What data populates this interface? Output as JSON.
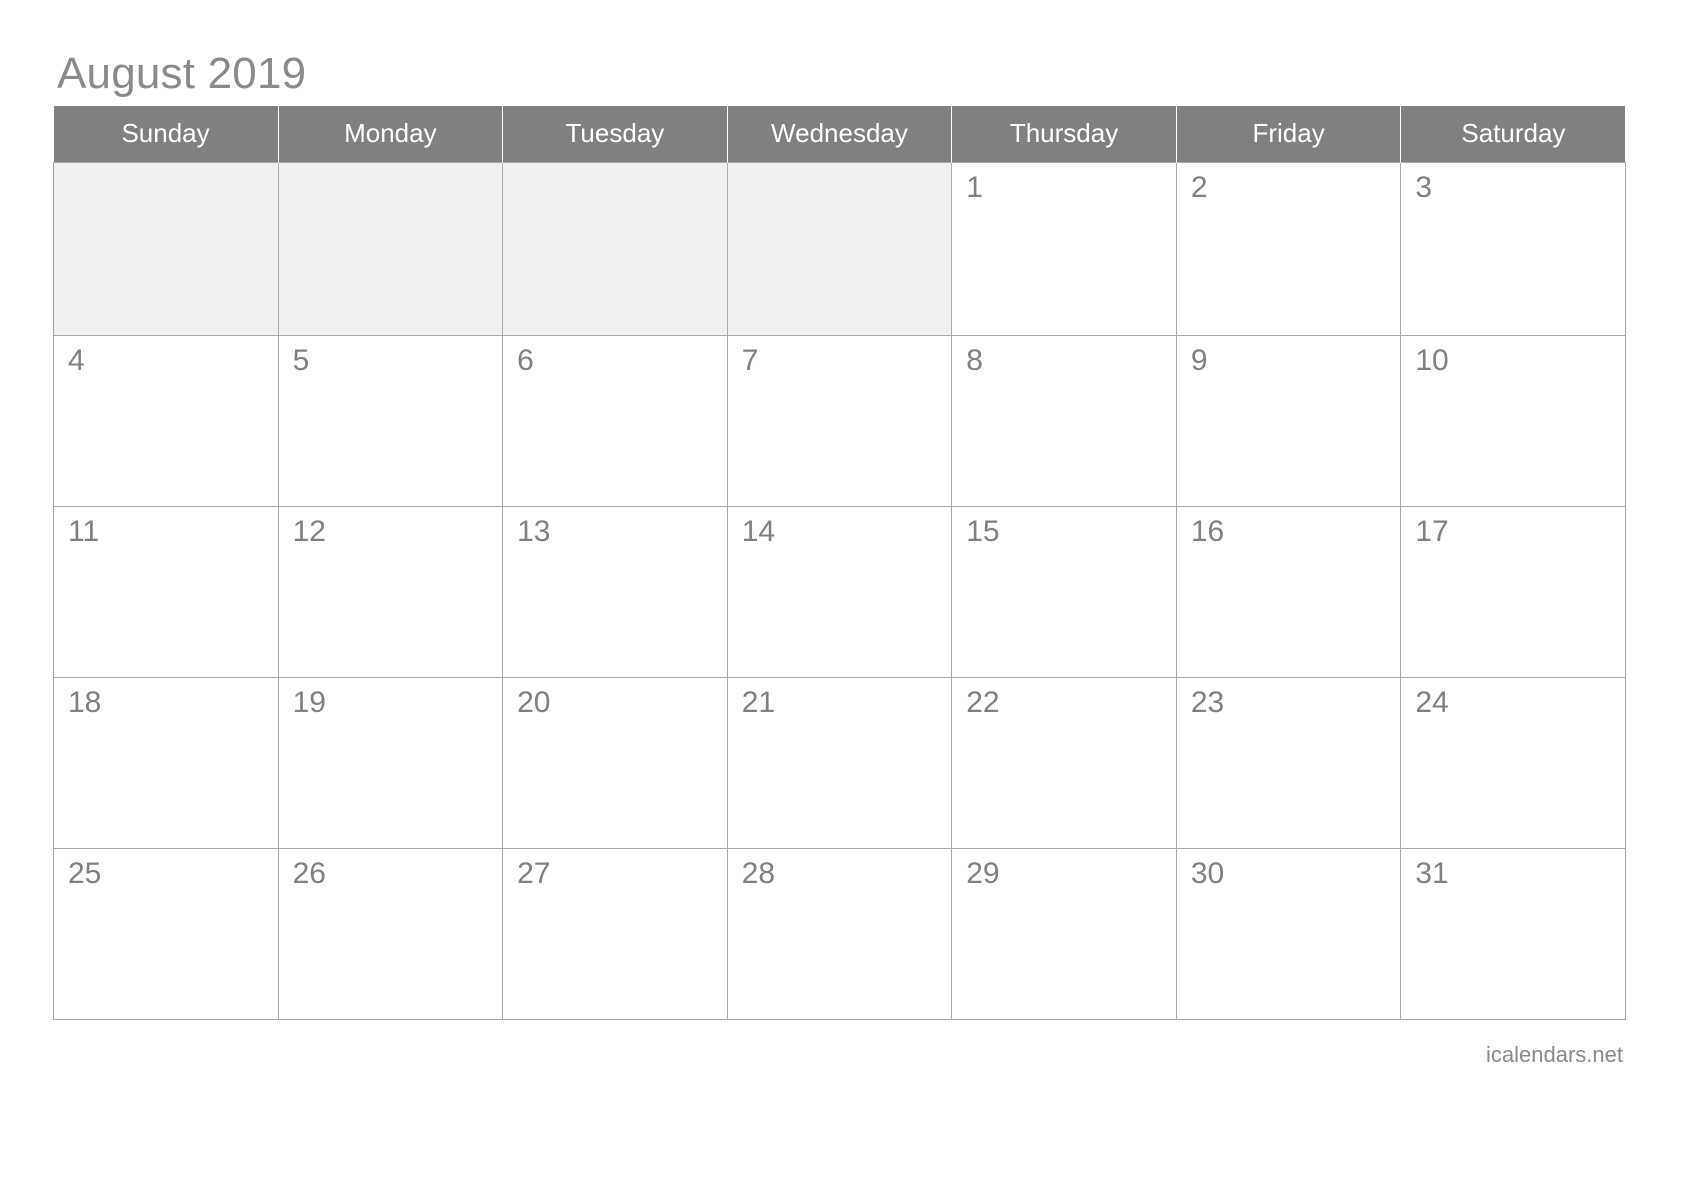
{
  "calendar": {
    "title": "August 2019",
    "month": "August",
    "year": "2019",
    "weekday_headers": [
      "Sunday",
      "Monday",
      "Tuesday",
      "Wednesday",
      "Thursday",
      "Friday",
      "Saturday"
    ],
    "weeks": [
      [
        {
          "label": "",
          "blank": true
        },
        {
          "label": "",
          "blank": true
        },
        {
          "label": "",
          "blank": true
        },
        {
          "label": "",
          "blank": true
        },
        {
          "label": "1",
          "blank": false
        },
        {
          "label": "2",
          "blank": false
        },
        {
          "label": "3",
          "blank": false
        }
      ],
      [
        {
          "label": "4",
          "blank": false
        },
        {
          "label": "5",
          "blank": false
        },
        {
          "label": "6",
          "blank": false
        },
        {
          "label": "7",
          "blank": false
        },
        {
          "label": "8",
          "blank": false
        },
        {
          "label": "9",
          "blank": false
        },
        {
          "label": "10",
          "blank": false
        }
      ],
      [
        {
          "label": "11",
          "blank": false
        },
        {
          "label": "12",
          "blank": false
        },
        {
          "label": "13",
          "blank": false
        },
        {
          "label": "14",
          "blank": false
        },
        {
          "label": "15",
          "blank": false
        },
        {
          "label": "16",
          "blank": false
        },
        {
          "label": "17",
          "blank": false
        }
      ],
      [
        {
          "label": "18",
          "blank": false
        },
        {
          "label": "19",
          "blank": false
        },
        {
          "label": "20",
          "blank": false
        },
        {
          "label": "21",
          "blank": false
        },
        {
          "label": "22",
          "blank": false
        },
        {
          "label": "23",
          "blank": false
        },
        {
          "label": "24",
          "blank": false
        }
      ],
      [
        {
          "label": "25",
          "blank": false
        },
        {
          "label": "26",
          "blank": false
        },
        {
          "label": "27",
          "blank": false
        },
        {
          "label": "28",
          "blank": false
        },
        {
          "label": "29",
          "blank": false
        },
        {
          "label": "30",
          "blank": false
        },
        {
          "label": "31",
          "blank": false
        }
      ]
    ],
    "footer": "icalendars.net",
    "colors": {
      "header_background": "#808080",
      "header_text": "#ffffff",
      "title_text": "#8a8a8a",
      "day_number_text": "#808080",
      "grid_border": "#a8a8a8",
      "blank_cell_background": "#f0f0f0",
      "cell_background": "#ffffff",
      "footer_text": "#8a8a8a",
      "page_background": "#ffffff"
    }
  }
}
